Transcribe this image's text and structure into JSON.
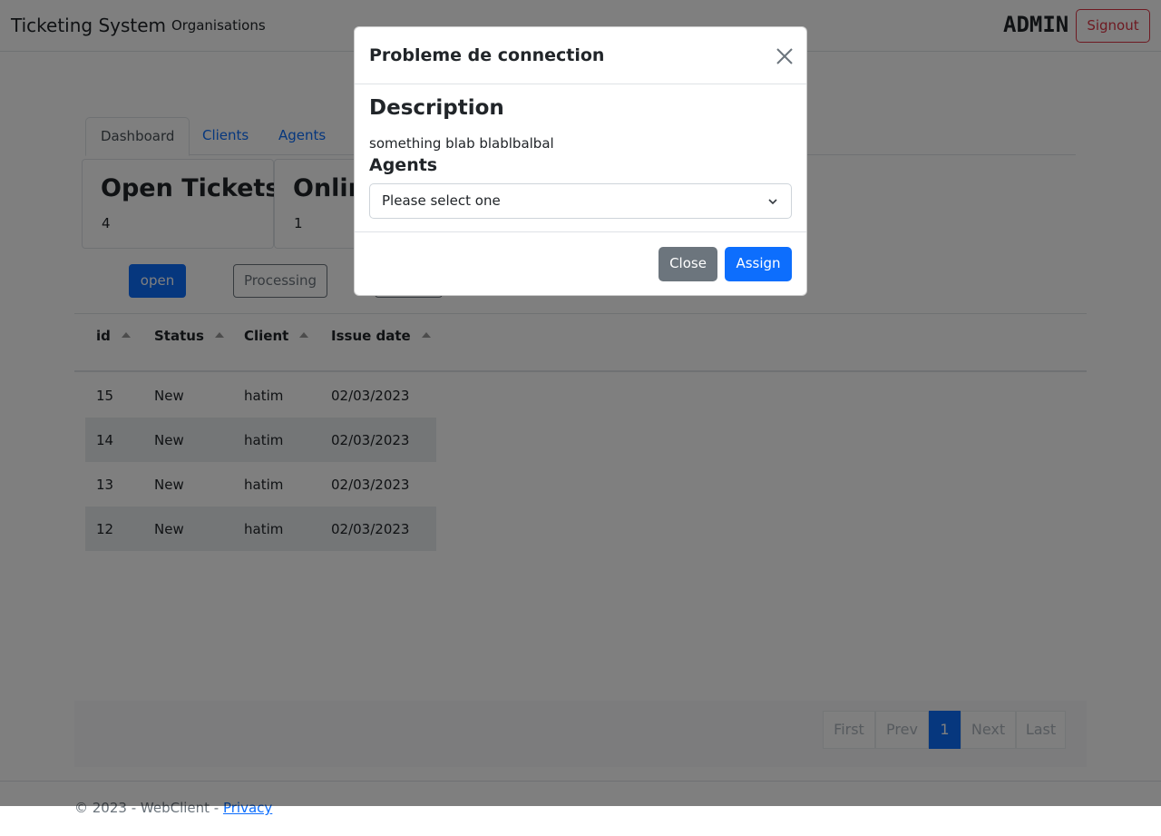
{
  "navbar": {
    "brand": "Ticketing System",
    "link": "Organisations",
    "user": "ADMIN",
    "signout": "Signout"
  },
  "tabs": [
    "Dashboard",
    "Clients",
    "Agents"
  ],
  "cards": [
    {
      "title": "Open Tickets",
      "value": "4"
    },
    {
      "title": "Onlin",
      "value": "1"
    }
  ],
  "filters": {
    "open": "open",
    "processing": "Processing",
    "third": ""
  },
  "table": {
    "columns": [
      "id",
      "Status",
      "Client",
      "Issue date"
    ],
    "rows": [
      [
        "15",
        "New",
        "hatim",
        "02/03/2023"
      ],
      [
        "14",
        "New",
        "hatim",
        "02/03/2023"
      ],
      [
        "13",
        "New",
        "hatim",
        "02/03/2023"
      ],
      [
        "12",
        "New",
        "hatim",
        "02/03/2023"
      ]
    ]
  },
  "pagination": [
    "First",
    "Prev",
    "1",
    "Next",
    "Last"
  ],
  "footer": {
    "text": "© 2023 - WebClient - ",
    "link": "Privacy"
  },
  "modal": {
    "title": "Probleme de connection",
    "description_heading": "Description",
    "description_text": "something blab blablbalbal",
    "agents_heading": "Agents",
    "select_value": "Please select one",
    "close_label": "Close",
    "assign_label": "Assign"
  },
  "colors": {
    "primary": "#0d6efd",
    "danger": "#dc3545",
    "secondary": "#6c757d"
  }
}
